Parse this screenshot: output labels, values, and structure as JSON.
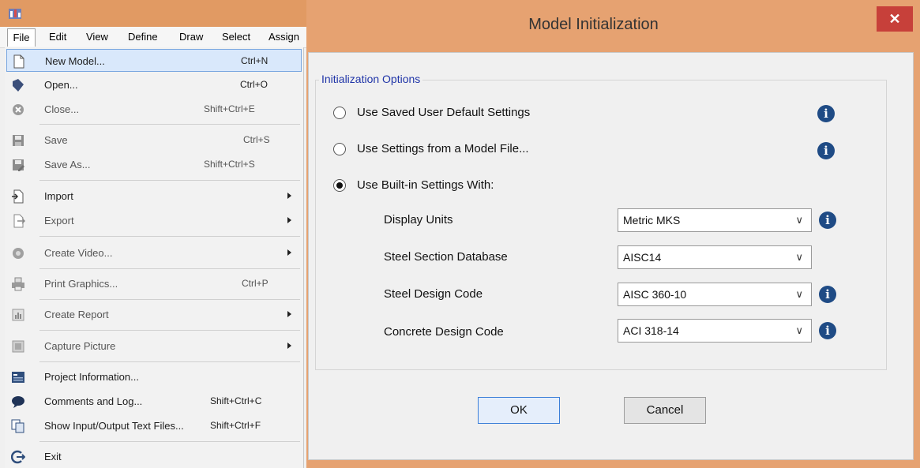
{
  "app": {
    "menubar": [
      "File",
      "Edit",
      "View",
      "Define",
      "Draw",
      "Select",
      "Assign"
    ],
    "file_menu": [
      {
        "label": "New Model...",
        "shortcut": "Ctrl+N",
        "icon": "new-document-icon"
      },
      {
        "label": "Open...",
        "shortcut": "Ctrl+O",
        "icon": "open-folder-icon"
      },
      {
        "label": "Close...",
        "shortcut": "Shift+Ctrl+E",
        "icon": "close-circle-icon"
      },
      {
        "label": "Save",
        "shortcut": "Ctrl+S",
        "icon": "save-icon"
      },
      {
        "label": "Save As...",
        "shortcut": "Shift+Ctrl+S",
        "icon": "save-as-icon"
      },
      {
        "label": "Import",
        "shortcut": "",
        "icon": "import-icon"
      },
      {
        "label": "Export",
        "shortcut": "",
        "icon": "export-icon"
      },
      {
        "label": "Create Video...",
        "shortcut": "",
        "icon": "video-icon"
      },
      {
        "label": "Print Graphics...",
        "shortcut": "Ctrl+P",
        "icon": "printer-icon"
      },
      {
        "label": "Create Report",
        "shortcut": "",
        "icon": "report-icon"
      },
      {
        "label": "Capture Picture",
        "shortcut": "",
        "icon": "capture-icon"
      },
      {
        "label": "Project Information...",
        "shortcut": "",
        "icon": "project-info-icon"
      },
      {
        "label": "Comments and Log...",
        "shortcut": "Shift+Ctrl+C",
        "icon": "comment-icon"
      },
      {
        "label": "Show Input/Output Text Files...",
        "shortcut": "Shift+Ctrl+F",
        "icon": "text-files-icon"
      },
      {
        "label": "Exit",
        "shortcut": "",
        "icon": "exit-icon"
      }
    ]
  },
  "dialog": {
    "title": "Model Initialization",
    "close_label": "✕",
    "group_label": "Initialization Options",
    "options": [
      "Use Saved User Default Settings",
      "Use Settings from a Model File...",
      "Use Built-in Settings With:"
    ],
    "selected_option": "Use Built-in Settings With:",
    "fields": [
      {
        "label": "Display Units",
        "value": "Metric MKS"
      },
      {
        "label": "Steel Section Database",
        "value": "AISC14"
      },
      {
        "label": "Steel Design Code",
        "value": "AISC 360-10"
      },
      {
        "label": "Concrete Design Code",
        "value": "ACI 318-14"
      }
    ],
    "ok_label": "OK",
    "cancel_label": "Cancel",
    "info_symbol": "i"
  },
  "colors": {
    "title_bar": "#e6a271",
    "close_button": "#c7403a",
    "group_label": "#2035a8",
    "info_icon": "#1f4b85",
    "menu_highlight": "#d9e8fb"
  }
}
